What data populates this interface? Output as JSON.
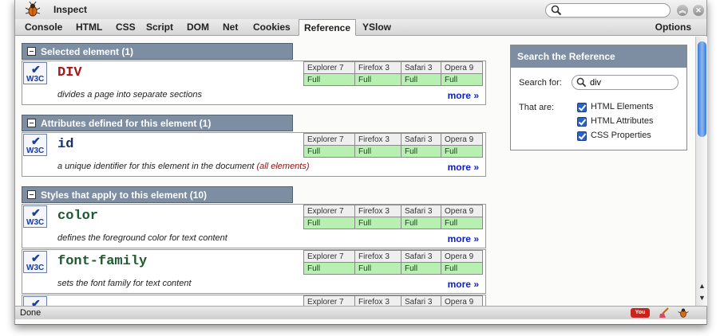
{
  "window": {
    "title": "Inspect"
  },
  "search": {
    "value": ""
  },
  "tabs": [
    {
      "label": "Console"
    },
    {
      "label": "HTML"
    },
    {
      "label": "CSS"
    },
    {
      "label": "Script"
    },
    {
      "label": "DOM"
    },
    {
      "label": "Net"
    },
    {
      "label": "Cookies"
    },
    {
      "label": "Reference",
      "active": true
    },
    {
      "label": "YSlow"
    }
  ],
  "options_label": "Options",
  "browsers": [
    "Explorer 7",
    "Firefox 3",
    "Safari 3",
    "Opera 9"
  ],
  "w3c_label": "W3C",
  "more_label": "more »",
  "sections": [
    {
      "header": "Selected element (1)",
      "items": [
        {
          "name": "DIV",
          "description": "divides a page into separate sections",
          "support": [
            "Full",
            "Full",
            "Full",
            "Full"
          ]
        }
      ]
    },
    {
      "header": "Attributes defined for this element (1)",
      "items": [
        {
          "name": "id",
          "description": "a unique identifier for this element in the document",
          "extra": "(all elements)",
          "support": [
            "Full",
            "Full",
            "Full",
            "Full"
          ]
        }
      ]
    },
    {
      "header": "Styles that apply to this element (10)",
      "items": [
        {
          "name": "color",
          "description": "defines the foreground color for text content",
          "support": [
            "Full",
            "Full",
            "Full",
            "Full"
          ]
        },
        {
          "name": "font-family",
          "description": "sets the font family for text content",
          "support": [
            "Full",
            "Full",
            "Full",
            "Full"
          ]
        }
      ]
    }
  ],
  "search_panel": {
    "title": "Search the Reference",
    "search_for_label": "Search for:",
    "search_value": "div",
    "that_are_label": "That are:",
    "options": [
      {
        "label": "HTML Elements",
        "checked": true
      },
      {
        "label": "HTML Attributes",
        "checked": true
      },
      {
        "label": "CSS Properties",
        "checked": true
      }
    ]
  },
  "status": {
    "text": "Done",
    "youtube_label": "You Tube"
  }
}
